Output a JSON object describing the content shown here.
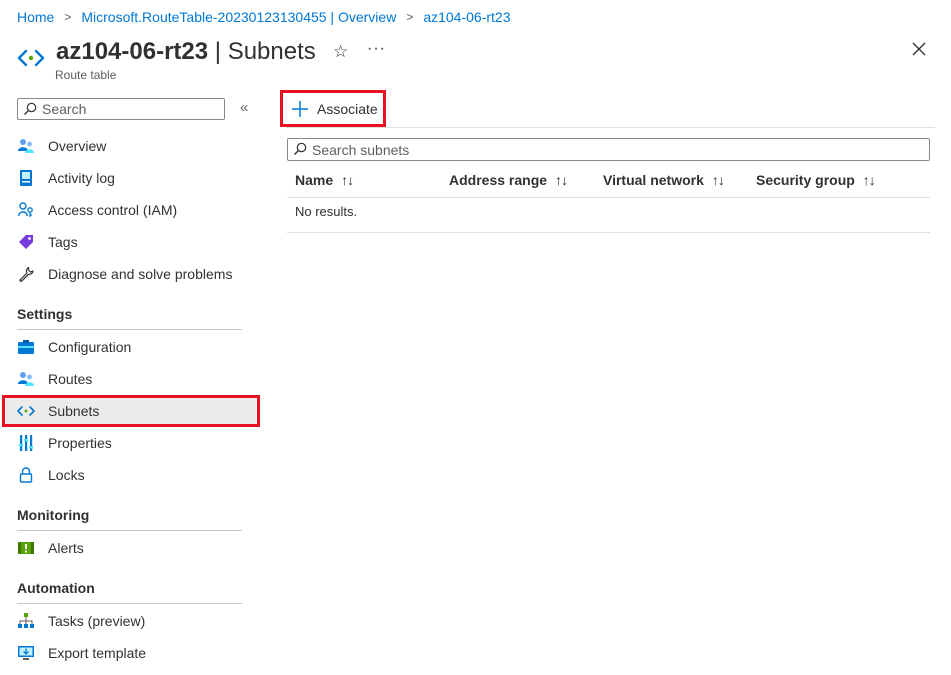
{
  "breadcrumb": [
    {
      "label": "Home"
    },
    {
      "label": "Microsoft.RouteTable-20230123130455 | Overview"
    },
    {
      "label": "az104-06-rt23"
    }
  ],
  "header": {
    "resource_name": "az104-06-rt23",
    "separator": " | ",
    "page_name": "Subnets",
    "subtitle": "Route table",
    "star_glyph": "☆",
    "more_glyph": "···"
  },
  "sidebar": {
    "search_placeholder": "Search",
    "collapse_glyph": "«",
    "items_top": [
      {
        "label": "Overview",
        "icon": "overview-icon"
      },
      {
        "label": "Activity log",
        "icon": "activity-log-icon"
      },
      {
        "label": "Access control (IAM)",
        "icon": "iam-icon"
      },
      {
        "label": "Tags",
        "icon": "tag-icon"
      },
      {
        "label": "Diagnose and solve problems",
        "icon": "wrench-icon"
      }
    ],
    "sections": [
      {
        "title": "Settings",
        "items": [
          {
            "label": "Configuration",
            "icon": "configuration-icon"
          },
          {
            "label": "Routes",
            "icon": "routes-icon"
          },
          {
            "label": "Subnets",
            "icon": "subnets-icon",
            "active": true
          },
          {
            "label": "Properties",
            "icon": "properties-icon"
          },
          {
            "label": "Locks",
            "icon": "lock-icon"
          }
        ]
      },
      {
        "title": "Monitoring",
        "items": [
          {
            "label": "Alerts",
            "icon": "alerts-icon"
          }
        ]
      },
      {
        "title": "Automation",
        "items": [
          {
            "label": "Tasks (preview)",
            "icon": "tasks-icon"
          },
          {
            "label": "Export template",
            "icon": "export-template-icon"
          }
        ]
      }
    ]
  },
  "main": {
    "associate_label": "Associate",
    "search_placeholder": "Search subnets",
    "columns": [
      "Name",
      "Address range",
      "Virtual network",
      "Security group"
    ],
    "sort_glyph": "↑↓",
    "empty_text": "No results."
  },
  "colors": {
    "accent": "#0078d4",
    "highlight_border": "#e81123",
    "active_bg": "#edebe9"
  }
}
